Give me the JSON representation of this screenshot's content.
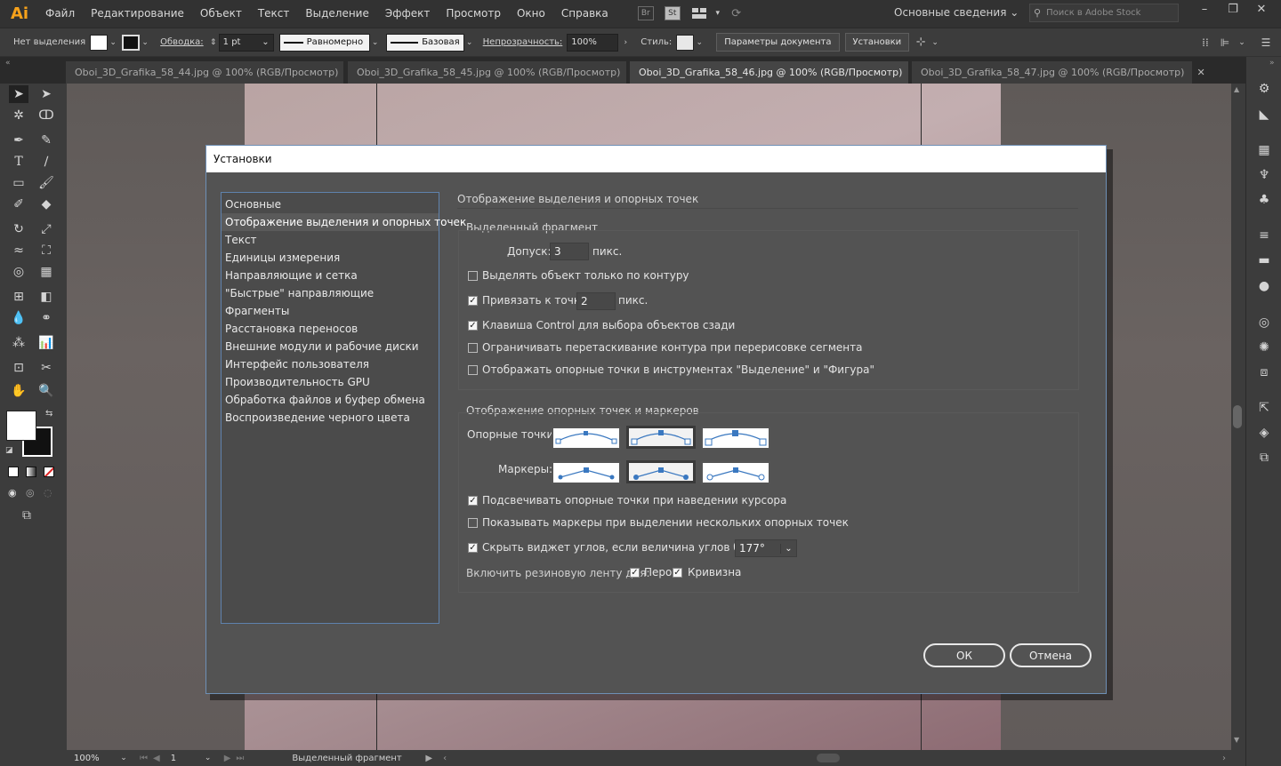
{
  "app": {
    "logo": "Ai"
  },
  "menubar": {
    "items": [
      "Файл",
      "Редактирование",
      "Объект",
      "Текст",
      "Выделение",
      "Эффект",
      "Просмотр",
      "Окно",
      "Справка"
    ],
    "bridge_label": "Br",
    "stock_label": "St",
    "workspace": "Основные сведения",
    "search_placeholder": "Поиск в Adobe Stock"
  },
  "controlbar": {
    "no_selection": "Нет выделения",
    "stroke_label": "Обводка:",
    "stroke_value": "1 pt",
    "profile_uniform": "Равномерно",
    "brush_basic": "Базовая",
    "opacity_label": "Непрозрачность:",
    "opacity_value": "100%",
    "style_label": "Стиль:",
    "doc_setup_button": "Параметры документа",
    "prefs_button": "Установки"
  },
  "tabs": [
    {
      "label": "Oboi_3D_Grafika_58_44.jpg @ 100% (RGB/Просмотр)",
      "active": false
    },
    {
      "label": "Oboi_3D_Grafika_58_45.jpg @ 100% (RGB/Просмотр)",
      "active": false
    },
    {
      "label": "Oboi_3D_Grafika_58_46.jpg @ 100% (RGB/Просмотр)",
      "active": true
    },
    {
      "label": "Oboi_3D_Grafika_58_47.jpg @ 100% (RGB/Просмотр)",
      "active": false
    }
  ],
  "statusbar": {
    "zoom": "100%",
    "artboard": "1",
    "status_text": "Выделенный фрагмент"
  },
  "dialog": {
    "title": "Установки",
    "categories": [
      "Основные",
      "Отображение выделения и опорных точек",
      "Текст",
      "Единицы измерения",
      "Направляющие и сетка",
      "\"Быстрые\" направляющие",
      "Фрагменты",
      "Расстановка переносов",
      "Внешние модули и рабочие диски",
      "Интерфейс пользователя",
      "Производительность GPU",
      "Обработка файлов и буфер обмена",
      "Воспроизведение черного цвета"
    ],
    "selected_category": "Отображение выделения и опорных точек",
    "section_title": "Отображение выделения и опорных точек",
    "selection": {
      "group_title": "Выделенный фрагмент",
      "tolerance_label": "Допуск:",
      "tolerance_value": "3",
      "tolerance_unit": "пикс.",
      "path_only_label": "Выделять объект только по контуру",
      "path_only_checked": false,
      "snap_label": "Привязать к точке",
      "snap_value": "2",
      "snap_unit": "пикс.",
      "snap_checked": true,
      "ctrl_label": "Клавиша Control для выбора объектов сзади",
      "ctrl_checked": true,
      "constrain_label": "Ограничивать перетаскивание контура при перерисовке сегмента",
      "constrain_checked": false,
      "show_anchors_label": "Отображать опорные точки в инструментах \"Выделение\" и \"Фигура\"",
      "show_anchors_checked": false
    },
    "anchors": {
      "group_title": "Отображение опорных точек и маркеров",
      "anchor_points_label": "Опорные точки:",
      "handles_label": "Маркеры:",
      "highlight_label": "Подсвечивать опорные точки при наведении курсора",
      "highlight_checked": true,
      "multi_label": "Показывать маркеры при выделении нескольких опорных точек",
      "multi_checked": false,
      "hide_widget_label": "Скрыть виджет углов, если величина углов более:",
      "hide_widget_checked": true,
      "angle_value": "177°",
      "rubber_label": "Включить резиновую ленту для:",
      "pen_label": "Перо",
      "pen_checked": true,
      "curvature_label": "Кривизна",
      "curvature_checked": true
    },
    "ok_label": "ОК",
    "cancel_label": "Отмена"
  },
  "colors": {
    "accent": "#5f82ad",
    "logo": "#f7a21b",
    "anchor_blue": "#3a78c0"
  }
}
